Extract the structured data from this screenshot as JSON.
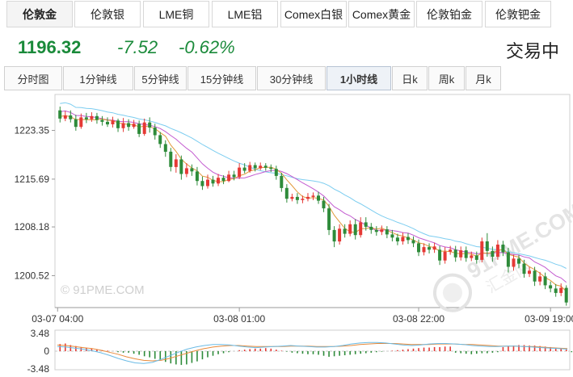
{
  "instruments": [
    "伦敦金",
    "伦敦银",
    "LME铜",
    "LME铝",
    "Comex白银",
    "Comex黄金",
    "伦敦铂金",
    "伦敦钯金"
  ],
  "quote": {
    "price": "1196.32",
    "change": "-7.52",
    "change_pct": "-0.62%",
    "status": "交易中"
  },
  "periods": [
    "分时图",
    "1分钟线",
    "5分钟线",
    "15分钟线",
    "30分钟线",
    "1小时线",
    "日k",
    "周k",
    "月k"
  ],
  "active_period": "1小时线",
  "watermark": {
    "left": "© 91PME.COM",
    "logo_text": "91PME.COM",
    "logo_sub": "汇金网"
  },
  "colors": {
    "up": "#e53935",
    "down": "#2e8b3a",
    "ma_purple": "#c35bd0",
    "ma_blue": "#7ccdf0",
    "ma_orange": "#e29a3a"
  },
  "chart_data": {
    "type": "candlestick",
    "y_ticks": [
      "1223.35",
      "1215.69",
      "1208.18",
      "1200.52"
    ],
    "x_ticks": [
      "03-07 04:00",
      "03-08 01:00",
      "03-08 22:00",
      "03-09 19:00"
    ],
    "macd_ticks": [
      "3.48",
      "0",
      "-3.48"
    ],
    "ylim": [
      1195.5,
      1229.0
    ],
    "candles": [
      [
        1226.5,
        1225.2,
        1227.1,
        1224.6
      ],
      [
        1225.2,
        1225.7,
        1226.4,
        1224.8
      ],
      [
        1225.7,
        1225.1,
        1226.5,
        1224.6
      ],
      [
        1225.1,
        1223.9,
        1225.8,
        1223.3
      ],
      [
        1223.9,
        1225.4,
        1226.0,
        1223.6
      ],
      [
        1225.4,
        1225.1,
        1226.1,
        1224.5
      ],
      [
        1225.1,
        1225.6,
        1226.2,
        1224.7
      ],
      [
        1225.6,
        1225.0,
        1226.1,
        1224.4
      ],
      [
        1225.0,
        1224.7,
        1225.6,
        1224.1
      ],
      [
        1224.7,
        1224.3,
        1225.4,
        1223.9
      ],
      [
        1224.3,
        1224.9,
        1225.5,
        1223.8
      ],
      [
        1224.9,
        1223.7,
        1225.2,
        1223.1
      ],
      [
        1223.7,
        1224.5,
        1225.3,
        1223.1
      ],
      [
        1224.5,
        1223.9,
        1225.1,
        1223.3
      ],
      [
        1223.9,
        1224.4,
        1225.0,
        1223.6
      ],
      [
        1224.4,
        1222.8,
        1224.9,
        1222.3
      ],
      [
        1222.8,
        1224.6,
        1225.2,
        1222.5
      ],
      [
        1224.6,
        1223.8,
        1225.4,
        1223.0
      ],
      [
        1223.8,
        1222.6,
        1224.4,
        1221.9
      ],
      [
        1222.6,
        1221.2,
        1223.1,
        1220.6
      ],
      [
        1221.2,
        1220.0,
        1221.8,
        1219.2
      ],
      [
        1220.0,
        1217.6,
        1220.6,
        1216.9
      ],
      [
        1217.6,
        1218.8,
        1219.6,
        1216.7
      ],
      [
        1218.8,
        1216.5,
        1219.4,
        1215.6
      ],
      [
        1216.5,
        1217.4,
        1218.2,
        1216.0
      ],
      [
        1217.4,
        1216.9,
        1218.0,
        1216.2
      ],
      [
        1216.9,
        1215.4,
        1217.6,
        1214.7
      ],
      [
        1215.4,
        1214.6,
        1216.1,
        1214.0
      ],
      [
        1214.6,
        1215.6,
        1216.4,
        1214.2
      ],
      [
        1215.6,
        1215.0,
        1216.2,
        1214.5
      ],
      [
        1215.0,
        1215.9,
        1216.5,
        1214.6
      ],
      [
        1215.9,
        1215.4,
        1216.3,
        1214.9
      ],
      [
        1215.4,
        1216.4,
        1217.0,
        1215.2
      ],
      [
        1216.4,
        1216.0,
        1217.0,
        1215.5
      ],
      [
        1216.0,
        1217.5,
        1218.2,
        1215.7
      ],
      [
        1217.5,
        1217.0,
        1218.2,
        1216.6
      ],
      [
        1217.0,
        1217.9,
        1218.4,
        1216.7
      ],
      [
        1217.9,
        1217.4,
        1218.3,
        1216.9
      ],
      [
        1217.4,
        1217.8,
        1218.3,
        1217.1
      ],
      [
        1217.8,
        1217.5,
        1218.2,
        1217.0
      ],
      [
        1217.5,
        1217.3,
        1218.0,
        1216.8
      ],
      [
        1217.3,
        1216.2,
        1217.8,
        1215.6
      ],
      [
        1216.2,
        1214.3,
        1216.7,
        1213.7
      ],
      [
        1214.3,
        1212.6,
        1214.9,
        1212.0
      ],
      [
        1212.6,
        1212.9,
        1213.4,
        1212.2
      ],
      [
        1212.9,
        1212.4,
        1213.5,
        1211.8
      ],
      [
        1212.4,
        1212.6,
        1213.1,
        1211.9
      ],
      [
        1212.6,
        1212.9,
        1213.5,
        1212.2
      ],
      [
        1212.9,
        1213.1,
        1213.6,
        1212.4
      ],
      [
        1213.1,
        1212.3,
        1213.7,
        1211.8
      ],
      [
        1212.3,
        1211.1,
        1212.9,
        1210.5
      ],
      [
        1211.1,
        1207.7,
        1211.8,
        1206.9
      ],
      [
        1207.7,
        1205.9,
        1208.3,
        1205.0
      ],
      [
        1205.9,
        1207.9,
        1208.6,
        1205.4
      ],
      [
        1207.9,
        1207.1,
        1208.6,
        1206.5
      ],
      [
        1207.1,
        1208.6,
        1209.2,
        1206.7
      ],
      [
        1208.6,
        1206.9,
        1209.4,
        1206.2
      ],
      [
        1206.9,
        1208.9,
        1209.7,
        1206.5
      ],
      [
        1208.9,
        1208.2,
        1209.7,
        1207.6
      ],
      [
        1208.2,
        1207.7,
        1208.8,
        1207.1
      ],
      [
        1207.7,
        1207.4,
        1208.3,
        1206.8
      ],
      [
        1207.4,
        1207.8,
        1208.4,
        1206.9
      ],
      [
        1207.8,
        1207.0,
        1208.3,
        1206.4
      ],
      [
        1207.0,
        1206.5,
        1207.7,
        1205.9
      ],
      [
        1206.5,
        1205.9,
        1207.1,
        1205.3
      ],
      [
        1205.9,
        1206.6,
        1207.3,
        1205.4
      ],
      [
        1206.6,
        1206.1,
        1207.2,
        1205.5
      ],
      [
        1206.1,
        1205.6,
        1206.7,
        1205.0
      ],
      [
        1205.6,
        1204.2,
        1206.2,
        1203.6
      ],
      [
        1204.2,
        1205.0,
        1205.6,
        1203.7
      ],
      [
        1205.0,
        1204.6,
        1205.6,
        1204.0
      ],
      [
        1204.6,
        1205.1,
        1205.7,
        1204.1
      ],
      [
        1204.6,
        1202.9,
        1205.2,
        1202.2
      ],
      [
        1202.9,
        1204.3,
        1205.0,
        1202.4
      ],
      [
        1204.3,
        1204.6,
        1205.2,
        1203.8
      ],
      [
        1204.6,
        1203.4,
        1205.2,
        1202.7
      ],
      [
        1203.4,
        1204.5,
        1205.1,
        1202.9
      ],
      [
        1204.5,
        1203.3,
        1205.1,
        1202.7
      ],
      [
        1203.3,
        1203.7,
        1204.3,
        1202.8
      ],
      [
        1203.7,
        1203.0,
        1204.3,
        1202.4
      ],
      [
        1203.0,
        1205.9,
        1206.5,
        1202.6
      ],
      [
        1205.9,
        1204.4,
        1207.2,
        1203.5
      ],
      [
        1204.4,
        1203.5,
        1205.1,
        1202.7
      ],
      [
        1203.5,
        1205.4,
        1206.1,
        1203.0
      ],
      [
        1205.4,
        1204.2,
        1206.0,
        1203.6
      ],
      [
        1204.2,
        1201.9,
        1204.9,
        1201.0
      ],
      [
        1201.9,
        1203.2,
        1203.8,
        1201.3
      ],
      [
        1203.2,
        1202.4,
        1203.8,
        1201.7
      ],
      [
        1202.4,
        1200.8,
        1203.0,
        1200.2
      ],
      [
        1200.8,
        1201.3,
        1201.9,
        1200.3
      ],
      [
        1201.3,
        1199.6,
        1201.9,
        1198.9
      ],
      [
        1199.6,
        1200.4,
        1201.1,
        1199.0
      ],
      [
        1200.4,
        1199.0,
        1201.0,
        1198.4
      ],
      [
        1199.0,
        1198.5,
        1199.6,
        1197.9
      ],
      [
        1198.5,
        1197.8,
        1199.2,
        1197.2
      ],
      [
        1197.8,
        1198.6,
        1199.3,
        1197.3
      ],
      [
        1198.6,
        1196.3,
        1199.0,
        1195.8
      ]
    ],
    "macd_hist": [
      1.4,
      1.5,
      1.2,
      1.0,
      0.8,
      0.6,
      0.5,
      0.3,
      0.2,
      0.1,
      0.0,
      -0.2,
      -0.3,
      -0.3,
      -0.5,
      -0.7,
      -1.0,
      -1.2,
      -1.5,
      -1.8,
      -2.1,
      -2.4,
      -2.6,
      -2.7,
      -2.6,
      -2.3,
      -2.0,
      -1.6,
      -1.2,
      -0.9,
      -0.6,
      -0.4,
      -0.2,
      0.0,
      0.2,
      0.3,
      0.4,
      0.5,
      0.5,
      0.6,
      0.5,
      0.3,
      0.1,
      -0.1,
      -0.3,
      -0.4,
      -0.5,
      -0.6,
      -0.6,
      -0.7,
      -0.9,
      -1.1,
      -1.0,
      -0.9,
      -0.8,
      -0.7,
      -0.6,
      -0.5,
      -0.4,
      -0.3,
      -0.2,
      -0.1,
      0.0,
      0.1,
      0.2,
      0.3,
      0.4,
      0.5,
      0.6,
      0.7,
      0.7,
      0.8,
      0.8,
      0.9,
      0.9,
      -0.3,
      -0.4,
      -0.5,
      -0.6,
      -0.5,
      -0.4,
      -0.4,
      -0.3,
      -0.2,
      0.8,
      1.0,
      1.1,
      1.2,
      1.2,
      1.1,
      1.1,
      1.0,
      0.9,
      0.8,
      0.7,
      0.5,
      0.3,
      -0.2,
      -0.4,
      -0.6
    ],
    "macd_dif": [
      0.9,
      0.8,
      0.6,
      0.4,
      0.1,
      -0.3,
      -0.8,
      -1.4,
      -1.9,
      -2.3,
      -2.4,
      -2.2,
      -1.6,
      -0.9,
      -0.2,
      0.4,
      0.8,
      1.1,
      1.3,
      1.3,
      1.2,
      1.0,
      0.8,
      0.7,
      0.8,
      0.9,
      1.0,
      1.1,
      1.0,
      0.9,
      0.8,
      0.8,
      0.9,
      1.1,
      1.4,
      1.6,
      1.7,
      1.7,
      1.6,
      1.4,
      1.2,
      1.1,
      1.2,
      1.4,
      1.5,
      1.5,
      1.4,
      1.3,
      1.1,
      1.0,
      0.9,
      0.9,
      1.0,
      1.0,
      0.9,
      0.8,
      0.7,
      0.6,
      0.5,
      0.4
    ],
    "macd_dea": [
      1.2,
      1.1,
      0.9,
      0.7,
      0.5,
      0.2,
      -0.2,
      -0.6,
      -1.1,
      -1.5,
      -1.8,
      -1.9,
      -1.8,
      -1.4,
      -0.9,
      -0.4,
      0.1,
      0.5,
      0.8,
      1.0,
      1.1,
      1.1,
      1.0,
      0.9,
      0.9,
      0.9,
      0.9,
      1.0,
      1.0,
      1.0,
      0.9,
      0.9,
      0.9,
      1.0,
      1.1,
      1.3,
      1.4,
      1.5,
      1.5,
      1.5,
      1.4,
      1.3,
      1.3,
      1.3,
      1.4,
      1.4,
      1.4,
      1.3,
      1.3,
      1.2,
      1.1,
      1.0,
      1.0,
      1.0,
      0.9,
      0.9,
      0.8,
      0.7,
      0.6,
      0.5
    ]
  }
}
